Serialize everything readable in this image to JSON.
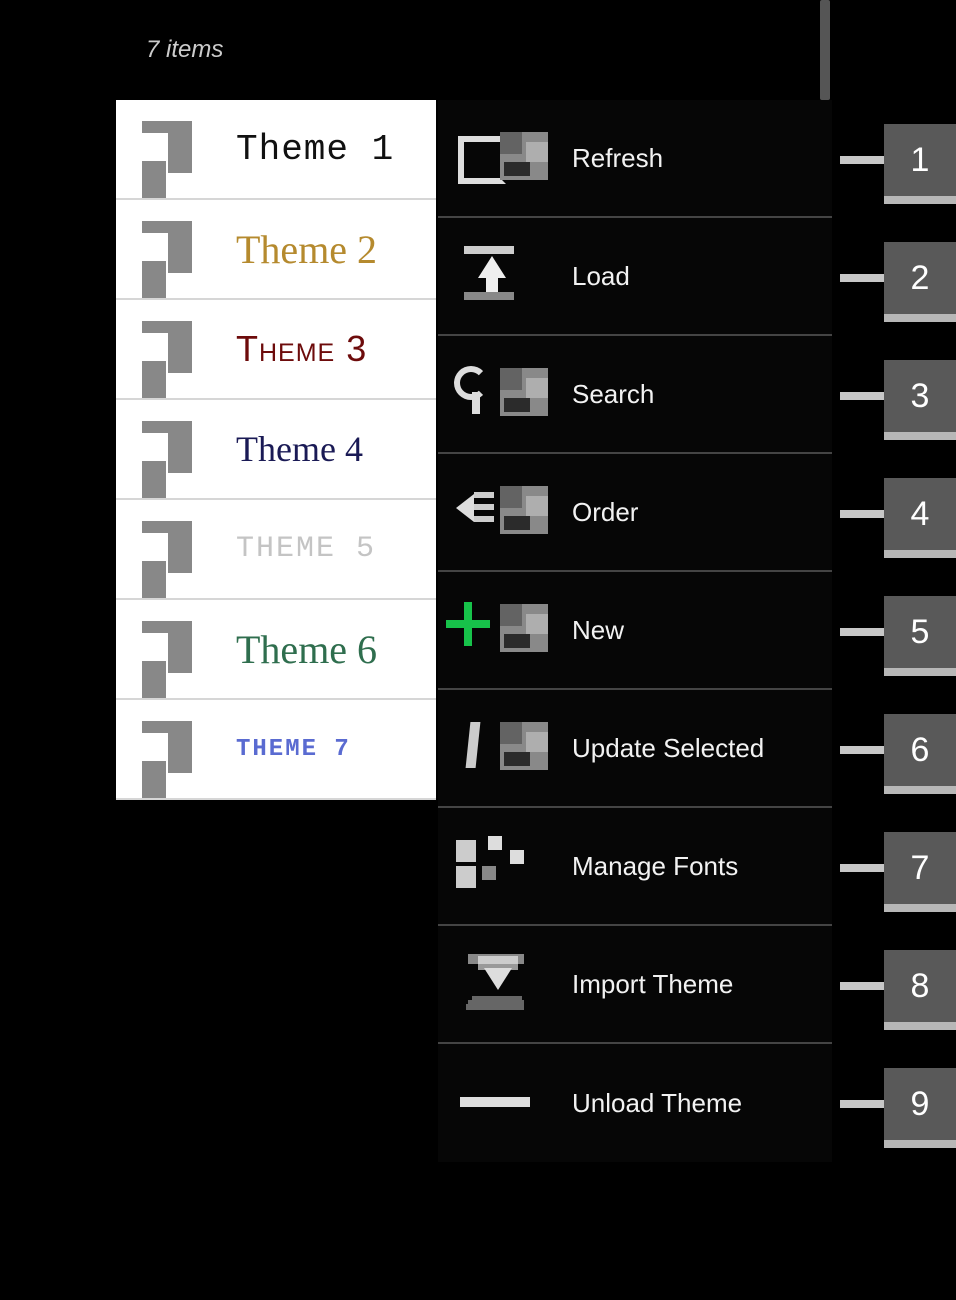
{
  "header": {
    "items_text": "7 items"
  },
  "themes": [
    {
      "label": "Theme 1",
      "style_class": "t1"
    },
    {
      "label": "Theme 2",
      "style_class": "t2"
    },
    {
      "label": "Theme 3",
      "style_class": "t3"
    },
    {
      "label": "Theme 4",
      "style_class": "t4"
    },
    {
      "label": "THEME 5",
      "style_class": "t5"
    },
    {
      "label": "Theme 6",
      "style_class": "t6"
    },
    {
      "label": "THEME 7",
      "style_class": "t7"
    }
  ],
  "menu": [
    {
      "label": "Refresh",
      "icon": "refresh"
    },
    {
      "label": "Load",
      "icon": "load"
    },
    {
      "label": "Search",
      "icon": "search"
    },
    {
      "label": "Order",
      "icon": "order"
    },
    {
      "label": "New",
      "icon": "new"
    },
    {
      "label": "Update Selected",
      "icon": "update"
    },
    {
      "label": "Manage Fonts",
      "icon": "fonts"
    },
    {
      "label": "Import Theme",
      "icon": "import"
    },
    {
      "label": "Unload Theme",
      "icon": "unload"
    }
  ],
  "callouts": [
    "1",
    "2",
    "3",
    "4",
    "5",
    "6",
    "7",
    "8",
    "9"
  ]
}
